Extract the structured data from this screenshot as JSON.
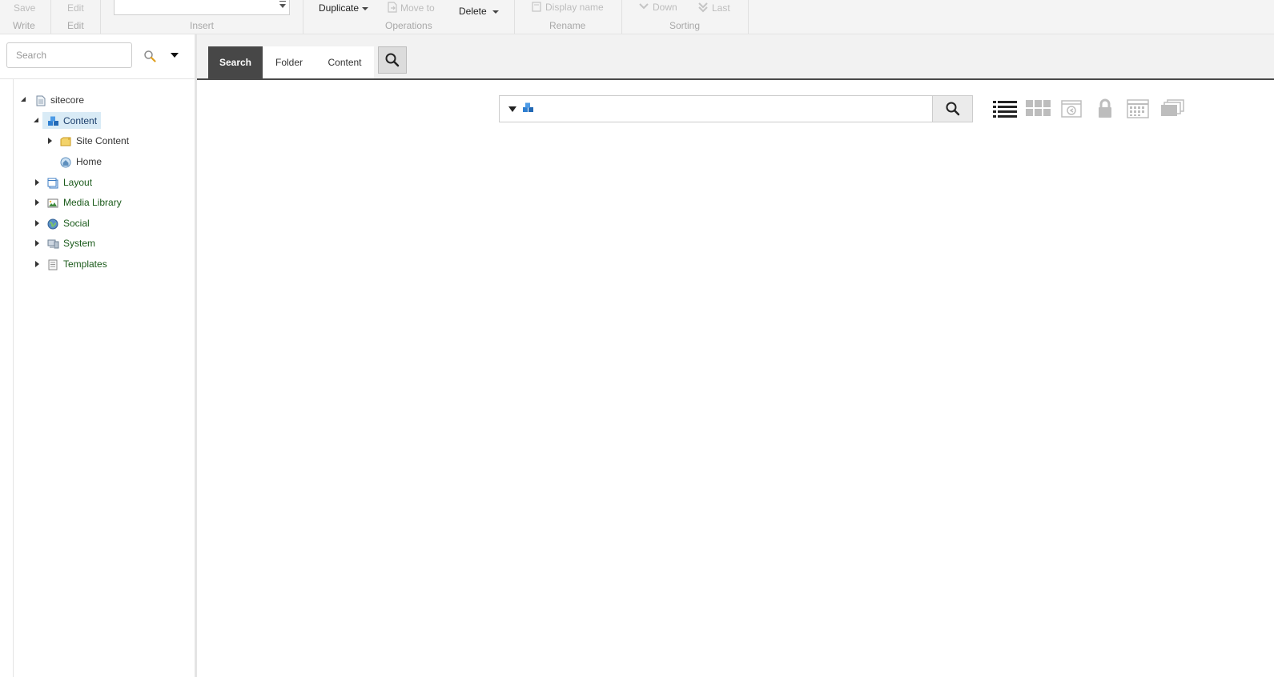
{
  "ribbon": {
    "write": {
      "top_label": "Save",
      "group_label": "Write"
    },
    "edit": {
      "top_label": "Edit",
      "group_label": "Edit"
    },
    "insert": {
      "group_label": "Insert",
      "value": ""
    },
    "operations": {
      "duplicate": "Duplicate",
      "move_to": "Move to",
      "delete": "Delete",
      "group_label": "Operations"
    },
    "rename": {
      "display_name": "Display name",
      "group_label": "Rename"
    },
    "sorting": {
      "down": "Down",
      "last": "Last",
      "group_label": "Sorting"
    }
  },
  "sidebar": {
    "search_placeholder": "Search",
    "tree": [
      {
        "label": "sitecore",
        "expanded": true,
        "level": 0
      },
      {
        "label": "Content",
        "expanded": true,
        "level": 1,
        "selected": true
      },
      {
        "label": "Site Content",
        "expanded": false,
        "level": 2
      },
      {
        "label": "Home",
        "level": 2
      },
      {
        "label": "Layout",
        "expanded": false,
        "level": 1
      },
      {
        "label": "Media Library",
        "expanded": false,
        "level": 1
      },
      {
        "label": "Social",
        "expanded": false,
        "level": 1
      },
      {
        "label": "System",
        "expanded": false,
        "level": 1
      },
      {
        "label": "Templates",
        "expanded": false,
        "level": 1
      }
    ]
  },
  "tabs": [
    {
      "label": "Search",
      "active": true
    },
    {
      "label": "Folder",
      "active": false
    },
    {
      "label": "Content",
      "active": false
    }
  ],
  "search_box": {
    "value": ""
  },
  "view_icons": [
    "list-view-icon",
    "grid-view-icon",
    "preview-view-icon",
    "lock-icon",
    "calendar-view-icon",
    "stack-view-icon"
  ],
  "colors": {
    "active_tab": "#474747",
    "selection": "#d9ebf6",
    "tree_text": "#1a5a1a"
  }
}
